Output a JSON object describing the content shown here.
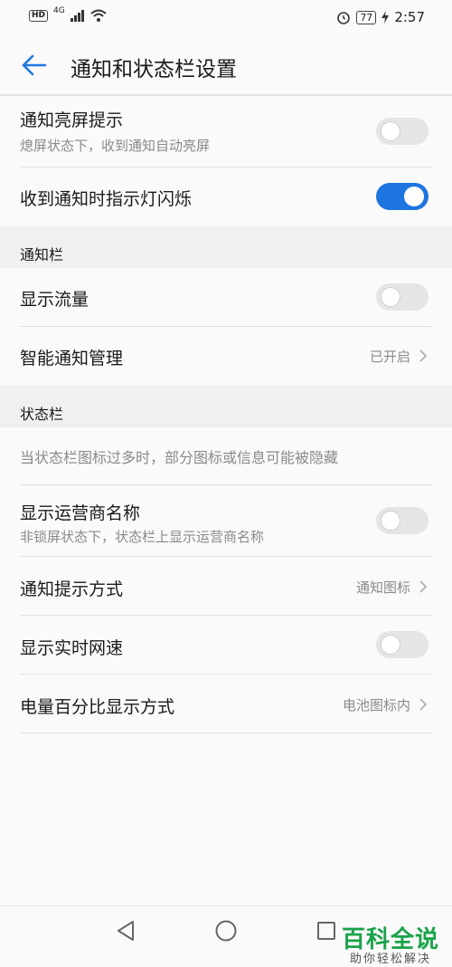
{
  "status_bar": {
    "hd": "HD",
    "network": "4G",
    "battery": "77",
    "time": "2:57",
    "icons": [
      "signal-icon",
      "wifi-icon",
      "alarm-icon",
      "battery-icon",
      "charging-icon"
    ]
  },
  "header": {
    "title": "通知和状态栏设置",
    "back_icon": "back-arrow-icon"
  },
  "rows": {
    "screen_wake": {
      "title": "通知亮屏提示",
      "subtitle": "熄屏状态下，收到通知自动亮屏",
      "toggle": false
    },
    "led_blink": {
      "title": "收到通知时指示灯闪烁",
      "toggle": true
    },
    "show_traffic": {
      "title": "显示流量",
      "toggle": false
    },
    "smart_notify": {
      "title": "智能通知管理",
      "value": "已开启"
    },
    "carrier_name": {
      "title": "显示运营商名称",
      "subtitle": "非锁屏状态下，状态栏上显示运营商名称",
      "toggle": false
    },
    "notify_style": {
      "title": "通知提示方式",
      "value": "通知图标"
    },
    "net_speed": {
      "title": "显示实时网速",
      "toggle": false
    },
    "battery_pct": {
      "title": "电量百分比显示方式",
      "value": "电池图标内"
    }
  },
  "sections": {
    "notification_bar": "通知栏",
    "status_bar": "状态栏",
    "status_bar_hint": "当状态栏图标过多时，部分图标或信息可能被隐藏"
  },
  "nav": {
    "icons": [
      "back-triangle-icon",
      "home-circle-icon",
      "recents-square-icon"
    ]
  },
  "watermark": {
    "main": "百科全说",
    "sub": "助你轻松解决"
  },
  "colors": {
    "accent": "#1f75e0",
    "toggle_off": "#e5e5e5",
    "section_bg": "#f0f0f0",
    "watermark": "#1aa34a"
  }
}
